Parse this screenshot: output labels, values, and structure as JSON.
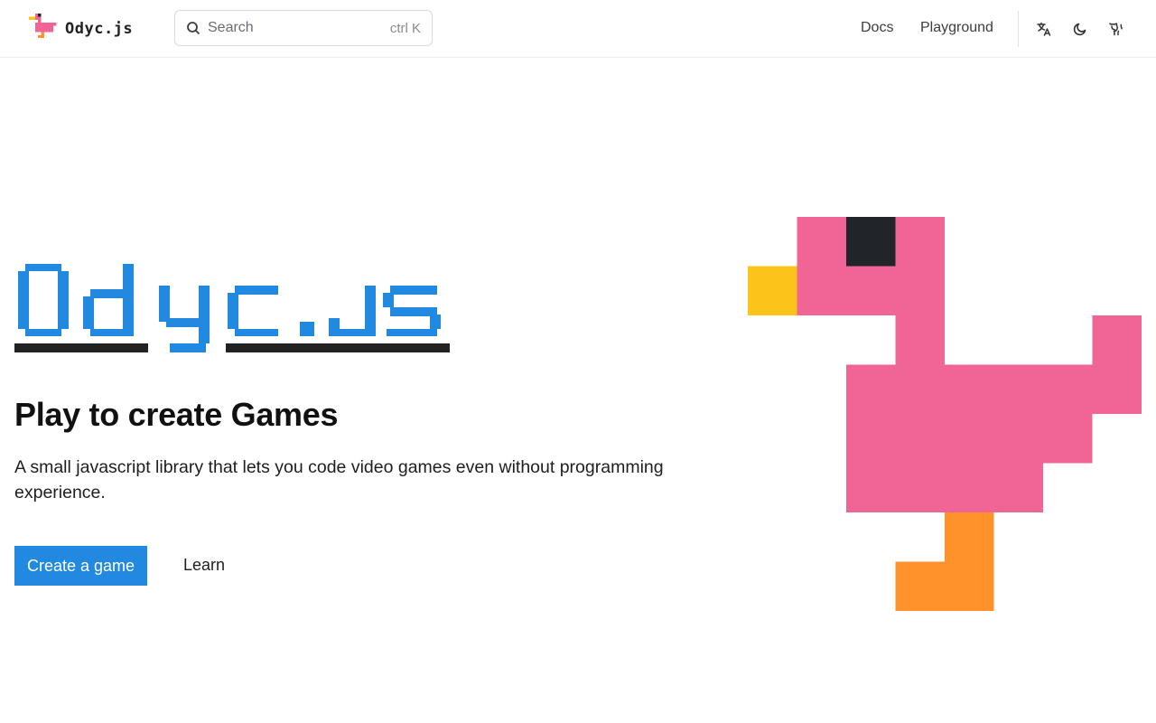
{
  "header": {
    "logo_text": "Odyc.js",
    "search": {
      "placeholder": "Search",
      "shortcut": "ctrl K"
    },
    "nav": [
      {
        "label": "Docs"
      },
      {
        "label": "Playground"
      }
    ],
    "icons": [
      "translate-icon",
      "moon-icon",
      "github-icon"
    ]
  },
  "hero": {
    "title": "Odyc.js",
    "tagline": "Play to create Games",
    "description": "A small javascript library that lets you code video games even without programming experience.",
    "primary_button": "Create a game",
    "secondary_link": "Learn"
  },
  "colors": {
    "brand_blue": "#2289e0",
    "duck_pink": "#f06595",
    "beak_yellow": "#fcc419",
    "leg_orange": "#ff922b",
    "eye_dark": "#212529"
  }
}
